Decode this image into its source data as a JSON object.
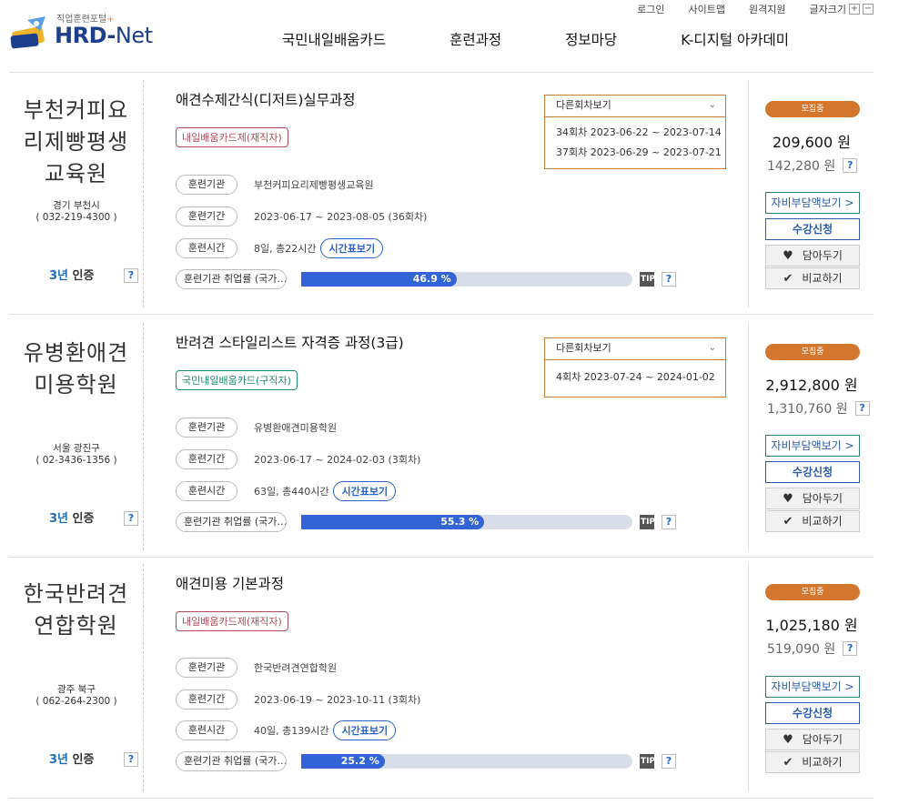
{
  "util": {
    "login": "로그인",
    "sitemap": "사이트맵",
    "remote": "원격지원",
    "fontsize": "글자크기",
    "plus": "+",
    "minus": "−"
  },
  "logo": {
    "sub": "직업훈련포털",
    "plus": "+",
    "name": "HRD-",
    "name2": "Net"
  },
  "gnb": [
    "국민내일배움카드",
    "훈련과정",
    "정보마당",
    "K-디지털 아카데미"
  ],
  "labels": {
    "rounds_head": "다른회차보기",
    "org": "훈련기관",
    "period": "훈련기간",
    "time": "훈련시간",
    "employ": "훈련기관 취업률 (국가…",
    "timetable": "시간표보기",
    "tip": "TIP",
    "q": "?",
    "status": "모집중",
    "self_pay": "자비부담액보기 >",
    "apply": "수강신청",
    "wish": "담아두기",
    "compare": "비교하기",
    "cert": "인증",
    "cert_num": "3년"
  },
  "courses": [
    {
      "inst": "부천커피요리제빵평생교육원",
      "region": "경기 부천시",
      "phone": "( 032-219-4300 )",
      "title": "애견수제간식(디저트)실무과정",
      "badge": "내일배움카드제(재직자)",
      "org": "부천커피요리제빵평생교육원",
      "period": "2023-06-17 ~ 2023-08-05 (36회차)",
      "time": "8일, 총22시간",
      "rate": 46.9,
      "rate_label": "46.9 %",
      "rounds": [
        "34회차 2023-06-22 ~ 2023-07-14",
        "37회차 2023-06-29 ~ 2023-07-21"
      ],
      "price": "209,600 원",
      "price2": "142,280 원"
    },
    {
      "inst": "유병환애견미용학원",
      "region": "서울 광진구",
      "phone": "( 02-3436-1356 )",
      "title": "반려견 스타일리스트 자격증 과정(3급)",
      "badge": "국민내일배움카드(구직자)",
      "org": "유병환애견미용학원",
      "period": "2023-06-17 ~ 2024-02-03 (3회차)",
      "time": "63일, 총440시간",
      "rate": 55.3,
      "rate_label": "55.3 %",
      "rounds": [
        "4회차 2023-07-24 ~ 2024-01-02"
      ],
      "price": "2,912,800 원",
      "price2": "1,310,760 원"
    },
    {
      "inst": "한국반려견연합학원",
      "region": "광주 북구",
      "phone": "( 062-264-2300 )",
      "title": "애견미용 기본과정",
      "badge": "내일배움카드제(재직자)",
      "org": "한국반려견연합학원",
      "period": "2023-06-19 ~ 2023-10-11 (3회차)",
      "time": "40일, 총139시간",
      "rate": 25.2,
      "rate_label": "25.2 %",
      "rounds": [],
      "price": "1,025,180 원",
      "price2": "519,090 원"
    }
  ]
}
